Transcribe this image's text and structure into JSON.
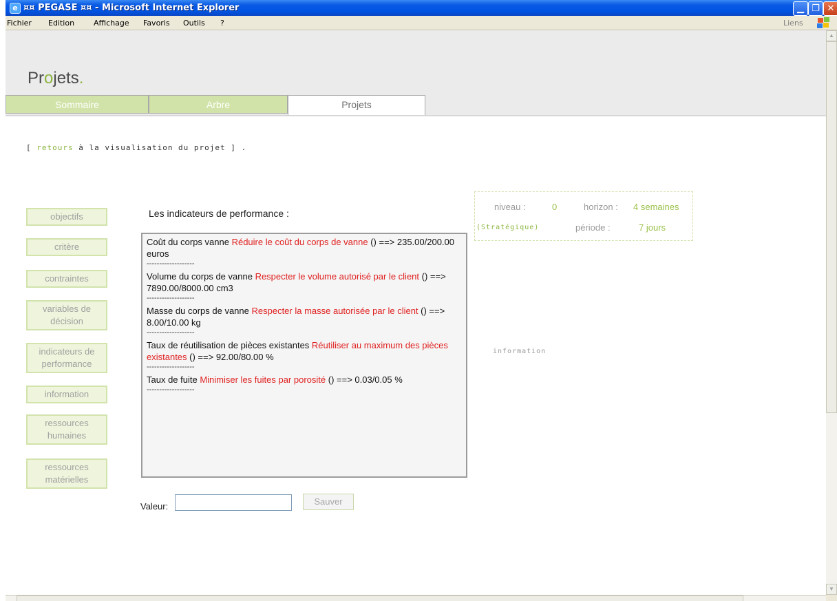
{
  "window": {
    "title": "¤¤ PEGASE ¤¤ - Microsoft Internet Explorer",
    "icon": "ie-icon"
  },
  "menu": {
    "items": [
      "Fichier",
      "Edition",
      "Affichage",
      "Favoris",
      "Outils",
      "?"
    ],
    "links_label": "Liens"
  },
  "page": {
    "title_prefix": "Pr",
    "title_o": "o",
    "title_suffix": "jets",
    "title_dot": "."
  },
  "tabs": [
    {
      "label": "Sommaire",
      "active": false
    },
    {
      "label": "Arbre",
      "active": false
    },
    {
      "label": "Projets",
      "active": true
    }
  ],
  "back": {
    "open": "[ ",
    "link": "retours",
    "rest": " à la visualisation du projet ] ."
  },
  "sidebar": {
    "buttons": [
      "objectifs",
      "critère",
      "contraintes",
      "variables de décision",
      "indicateurs de performance",
      "information",
      "ressources humaines",
      "ressources matérielles"
    ]
  },
  "indicators": {
    "title": "Les indicateurs de performance :",
    "separator": "-------------------",
    "entries": [
      {
        "name": "Coût du corps vanne ",
        "goal": "Réduire le coût du corps de vanne",
        "result": " () ==> 235.00/200.00 euros"
      },
      {
        "name": "Volume du corps de vanne ",
        "goal": "Respecter le volume autorisé par le client",
        "result": " () ==> 7890.00/8000.00 cm3"
      },
      {
        "name": "Masse du corps de vanne ",
        "goal": "Respecter la masse autorisée par le client",
        "result": " () ==> 8.00/10.00 kg"
      },
      {
        "name": "Taux de réutilisation de pièces existantes ",
        "goal": "Réutiliser au maximum des pièces existantes",
        "result": " () ==> 92.00/80.00 %"
      },
      {
        "name": "Taux de fuite ",
        "goal": "Minimiser les fuites par porosité",
        "result": " () ==> 0.03/0.05 %"
      }
    ]
  },
  "information": {
    "legend": "information",
    "niveau_label": "niveau :",
    "niveau_value": "0",
    "horizon_label": "horizon :",
    "horizon_value": "4 semaines",
    "type": "(Stratégique)",
    "periode_label": "période :",
    "periode_value": "7 jours"
  },
  "form": {
    "valeur_label": "Valeur:",
    "valeur_value": "",
    "save_label": "Sauver"
  },
  "colors": {
    "accent_green": "#8bb540",
    "goal_red": "#e02020",
    "tab_inactive_bg": "#d1e3a8"
  }
}
